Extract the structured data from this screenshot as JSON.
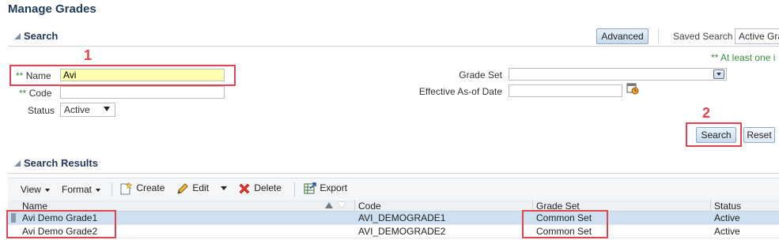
{
  "page_title": "Manage Grades",
  "search": {
    "header": "Search",
    "advanced_label": "Advanced",
    "saved_search_label": "Saved Search",
    "saved_search_value": "Active Grad",
    "at_least_one": "** At least one i",
    "fields": {
      "name_req": "**",
      "name_label": "Name",
      "name_value": "Avi",
      "code_req": "**",
      "code_label": "Code",
      "code_value": "",
      "status_label": "Status",
      "status_value": "Active",
      "grade_set_label": "Grade Set",
      "grade_set_value": "",
      "effective_label": "Effective As-of Date",
      "effective_value": ""
    },
    "search_button": "Search",
    "reset_button": "Reset"
  },
  "annotations": {
    "step1": "1",
    "step2": "2"
  },
  "results": {
    "header": "Search Results",
    "toolbar": {
      "view": "View",
      "format": "Format",
      "create": "Create",
      "edit": "Edit",
      "delete": "Delete",
      "export": "Export"
    },
    "columns": [
      "Name",
      "Code",
      "Grade Set",
      "Status"
    ],
    "rows": [
      {
        "name": "Avi Demo Grade1",
        "code": "AVI_DEMOGRADE1",
        "grade_set": "Common Set",
        "status": "Active"
      },
      {
        "name": "Avi Demo Grade2",
        "code": "AVI_DEMOGRADE2",
        "grade_set": "Common Set",
        "status": "Active"
      }
    ]
  },
  "colors": {
    "title": "#1f3a5a",
    "required": "#3b8a3b",
    "highlight_input": "#ffffb0",
    "annotation_red": "#e0454d",
    "selected_row": "#cfe0f1"
  }
}
